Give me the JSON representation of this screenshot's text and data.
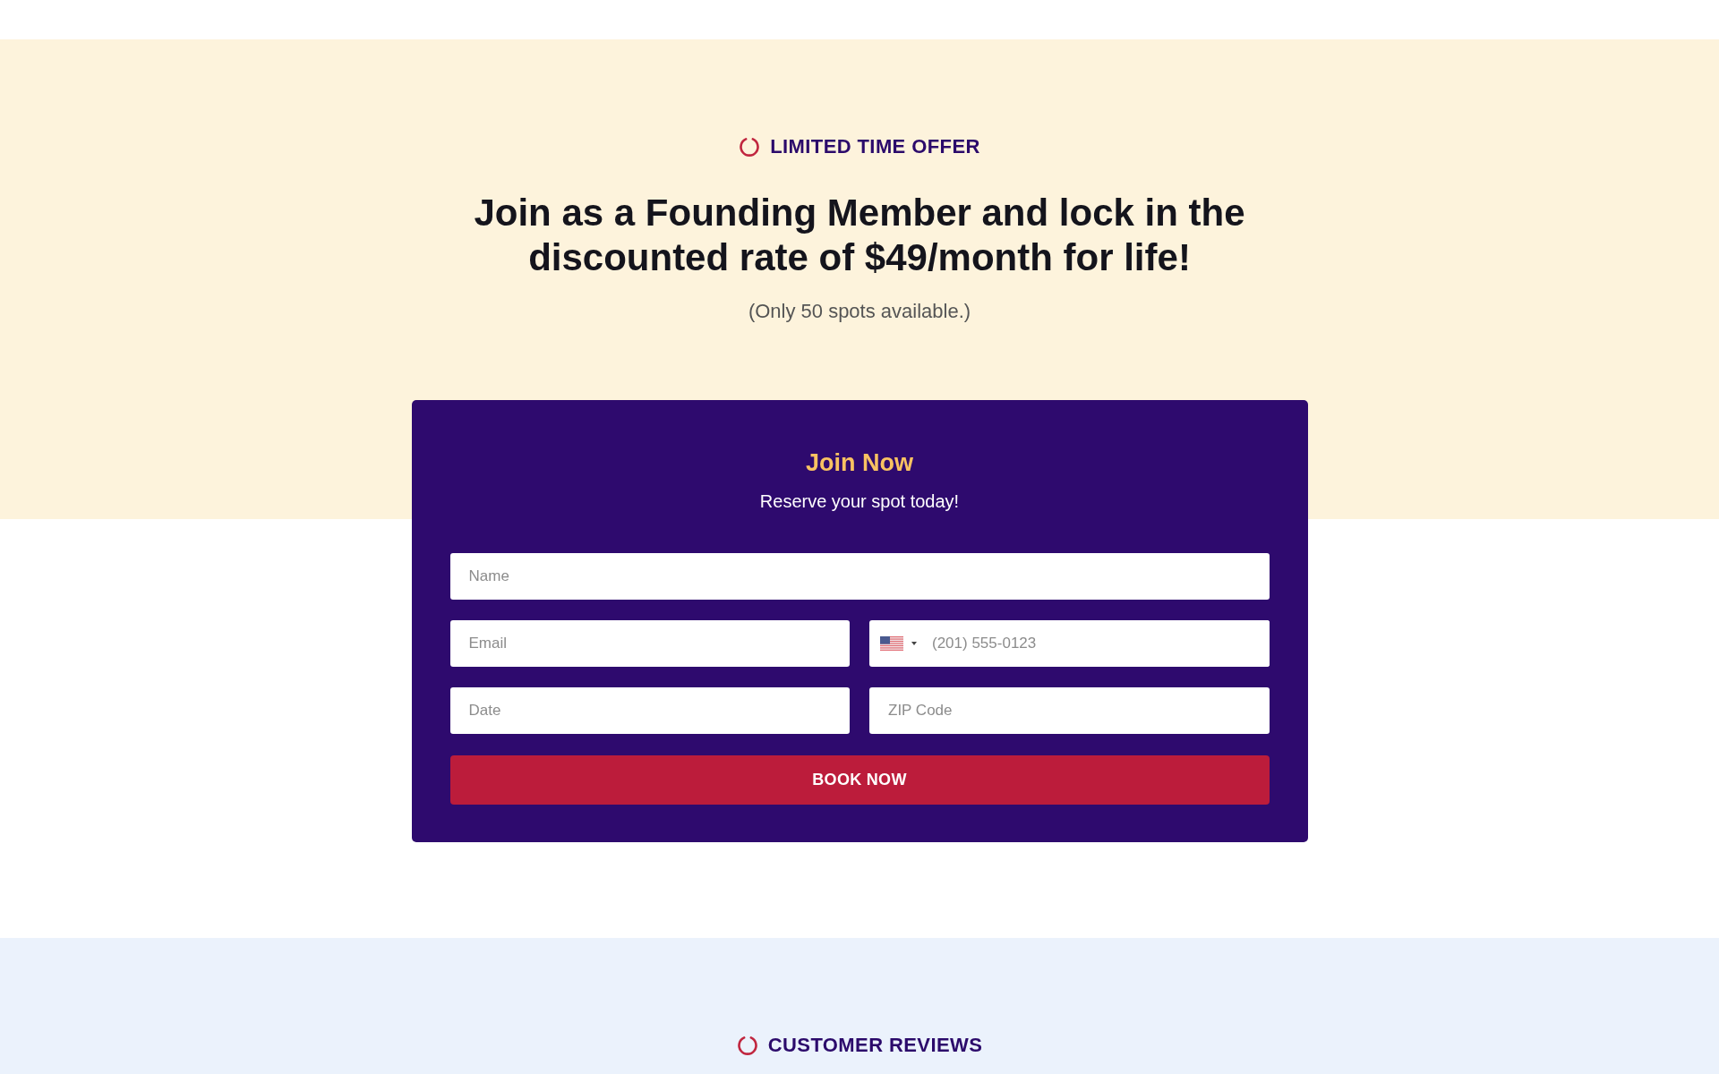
{
  "offer": {
    "eyebrow": "LIMITED TIME OFFER",
    "heading": "Join as a Founding Member and lock in the discounted rate of $49/month for life!",
    "note": "(Only 50 spots available.)"
  },
  "form": {
    "title": "Join Now",
    "subtitle": "Reserve your spot today!",
    "rows": [
      {
        "fields": [
          {
            "kind": "text",
            "placeholder": "Name"
          }
        ]
      },
      {
        "fields": [
          {
            "kind": "text",
            "placeholder": "Email"
          },
          {
            "kind": "phone",
            "placeholder": "(201) 555-0123"
          }
        ]
      },
      {
        "fields": [
          {
            "kind": "text",
            "placeholder": "Date"
          },
          {
            "kind": "text",
            "placeholder": "ZIP Code"
          }
        ]
      }
    ],
    "button": "BOOK NOW"
  },
  "reviews": {
    "eyebrow": "CUSTOMER REVIEWS"
  }
}
